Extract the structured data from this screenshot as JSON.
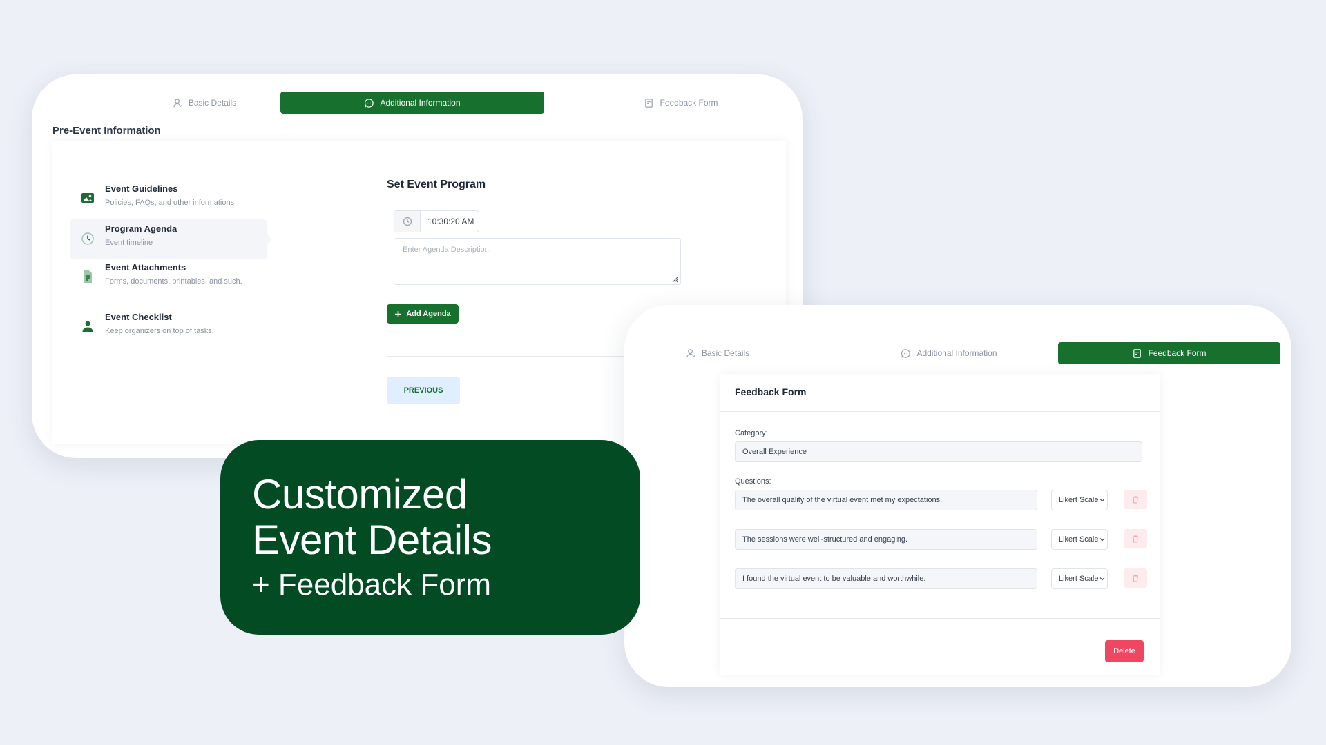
{
  "details_card": {
    "tabs": [
      {
        "label": "Basic Details",
        "icon": "user-icon",
        "active": false
      },
      {
        "label": "Additional Information",
        "icon": "chat-icon",
        "active": true
      },
      {
        "label": "Feedback Form",
        "icon": "form-icon",
        "active": false
      }
    ],
    "section_title": "Pre-Event Information",
    "sidebar": [
      {
        "title": "Event Guidelines",
        "subtitle": "Policies, FAQs, and other informations",
        "icon": "image-icon"
      },
      {
        "title": "Program Agenda",
        "subtitle": "Event timeline",
        "icon": "clock-icon",
        "selected": true
      },
      {
        "title": "Event Attachments",
        "subtitle": "Forms, documents, printables, and such.",
        "icon": "document-icon"
      },
      {
        "title": "Event Checklist",
        "subtitle": "Keep organizers on top of tasks.",
        "icon": "person-icon"
      }
    ],
    "program": {
      "title": "Set Event Program",
      "time_value": "10:30:20 AM",
      "agenda_placeholder": "Enter Agenda Description.",
      "add_button": "Add Agenda",
      "previous_button": "PREVIOUS"
    }
  },
  "banner": {
    "line1": "Customized",
    "line2": "Event Details",
    "line3": "+ Feedback Form"
  },
  "feedback_card": {
    "tabs": [
      {
        "label": "Basic Details",
        "icon": "user-icon",
        "active": false
      },
      {
        "label": "Additional Information",
        "icon": "chat-icon",
        "active": false
      },
      {
        "label": "Feedback Form",
        "icon": "form-icon",
        "active": true
      }
    ],
    "title": "Feedback Form",
    "category_label": "Category:",
    "category_value": "Overall Experience",
    "questions_label": "Questions:",
    "questions": [
      {
        "text": "The overall quality of the virtual event met my expectations.",
        "type": "Likert Scale"
      },
      {
        "text": "The sessions were well-structured and engaging.",
        "type": "Likert Scale"
      },
      {
        "text": "I found the virtual event to be valuable and worthwhile.",
        "type": "Likert Scale"
      }
    ],
    "delete_button": "Delete"
  },
  "colors": {
    "primary_green": "#17702e",
    "banner_green": "#024b23",
    "background": "#edf0f7",
    "danger": "#ef4761",
    "previous_bg": "#e0efff"
  }
}
